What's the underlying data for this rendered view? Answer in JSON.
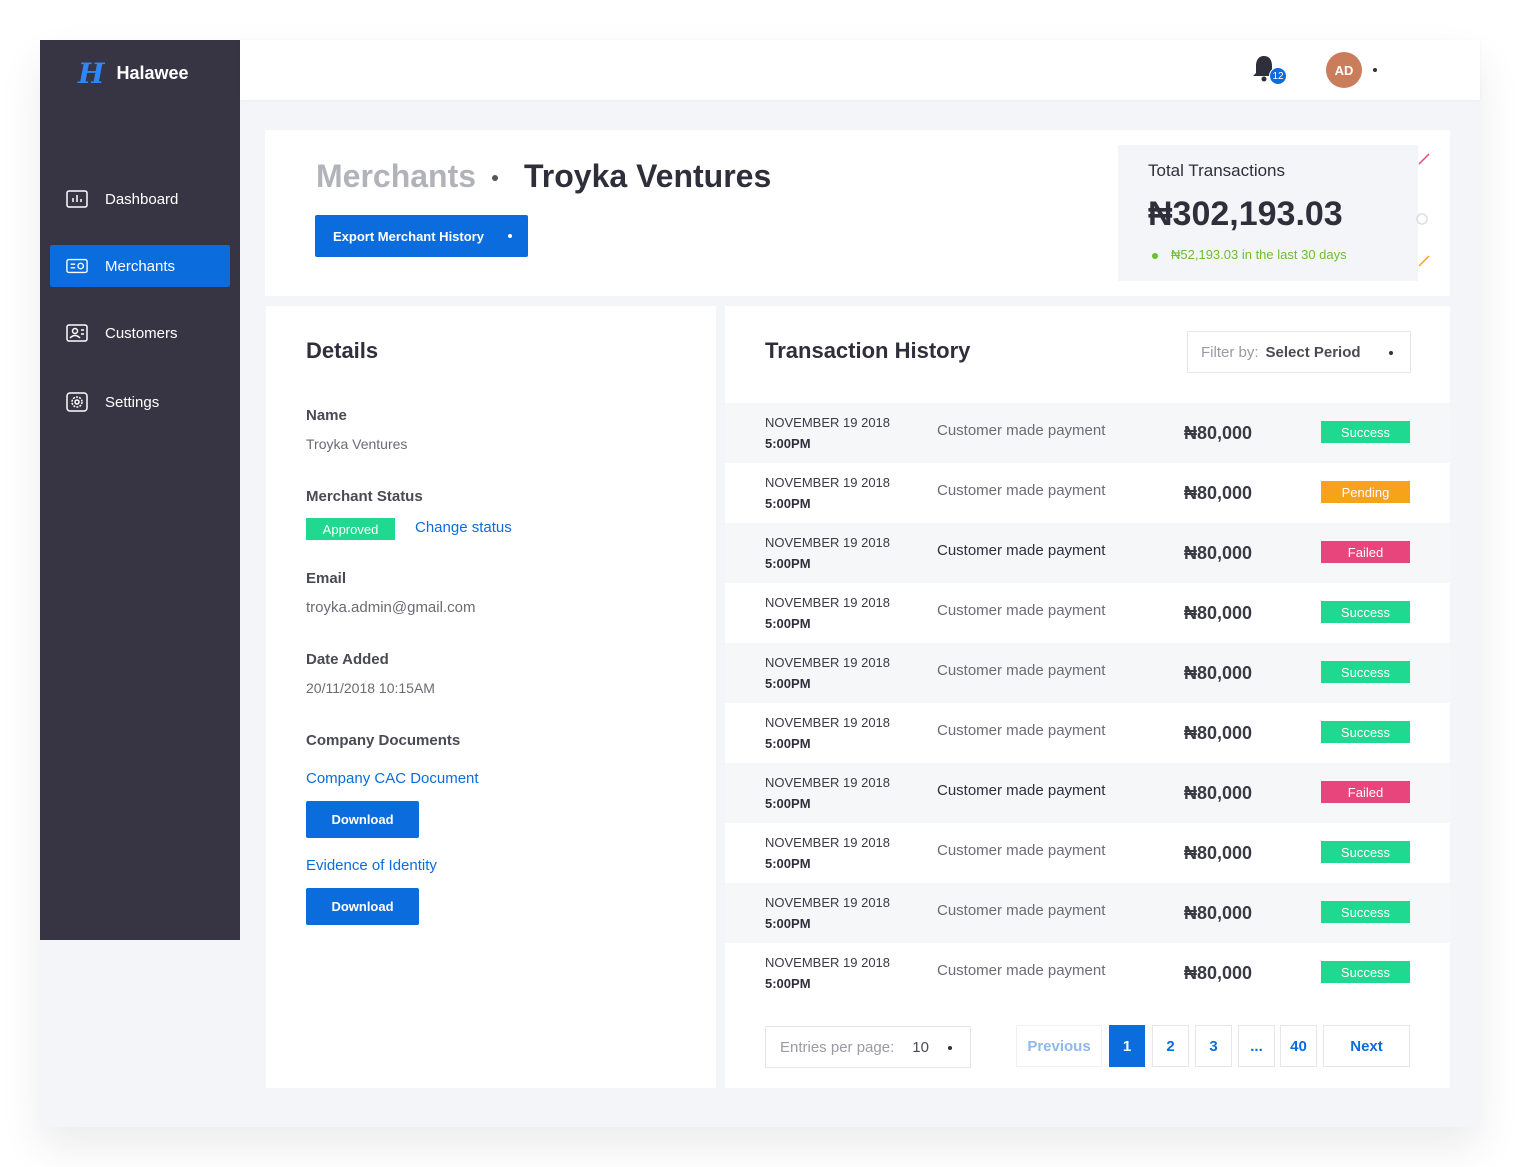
{
  "brand": {
    "logo": "H",
    "name": "Halawee"
  },
  "sidebar": {
    "items": [
      {
        "label": "Dashboard",
        "icon": "bar-chart-icon"
      },
      {
        "label": "Merchants",
        "icon": "id-card-icon",
        "active": true
      },
      {
        "label": "Customers",
        "icon": "user-card-icon"
      },
      {
        "label": "Settings",
        "icon": "gear-icon"
      }
    ]
  },
  "topbar": {
    "notification_count": "12",
    "avatar_initials": "AD"
  },
  "header": {
    "breadcrumb_parent": "Merchants",
    "breadcrumb_current": "Troyka Ventures",
    "export_label": "Export Merchant History",
    "total_label": "Total Transactions",
    "total_value": "₦302,193.03",
    "total_delta": "₦52,193.03 in the last 30 days"
  },
  "details": {
    "title": "Details",
    "name_label": "Name",
    "name_value": "Troyka Ventures",
    "status_label": "Merchant Status",
    "status_value": "Approved",
    "change_status_label": "Change status",
    "email_label": "Email",
    "email_value": "troyka.admin@gmail.com",
    "date_label": "Date Added",
    "date_value": "20/11/2018 10:15AM",
    "docs_label": "Company Documents",
    "doc1_label": "Company CAC Document",
    "doc2_label": "Evidence of Identity",
    "download_label": "Download"
  },
  "transactions": {
    "title": "Transaction History",
    "filter_label": "Filter by:",
    "filter_value": "Select Period",
    "rows": [
      {
        "date": "NOVEMBER 19 2018",
        "time": "5:00PM",
        "description": "Customer made payment",
        "amount": "₦80,000",
        "status": "Success"
      },
      {
        "date": "NOVEMBER 19 2018",
        "time": "5:00PM",
        "description": "Customer made payment",
        "amount": "₦80,000",
        "status": "Pending"
      },
      {
        "date": "NOVEMBER 19 2018",
        "time": "5:00PM",
        "description": "Customer made payment",
        "amount": "₦80,000",
        "status": "Failed"
      },
      {
        "date": "NOVEMBER 19 2018",
        "time": "5:00PM",
        "description": "Customer made payment",
        "amount": "₦80,000",
        "status": "Success"
      },
      {
        "date": "NOVEMBER 19 2018",
        "time": "5:00PM",
        "description": "Customer made payment",
        "amount": "₦80,000",
        "status": "Success"
      },
      {
        "date": "NOVEMBER 19 2018",
        "time": "5:00PM",
        "description": "Customer made payment",
        "amount": "₦80,000",
        "status": "Success"
      },
      {
        "date": "NOVEMBER 19 2018",
        "time": "5:00PM",
        "description": "Customer made payment",
        "amount": "₦80,000",
        "status": "Failed"
      },
      {
        "date": "NOVEMBER 19 2018",
        "time": "5:00PM",
        "description": "Customer made payment",
        "amount": "₦80,000",
        "status": "Success"
      },
      {
        "date": "NOVEMBER 19 2018",
        "time": "5:00PM",
        "description": "Customer made payment",
        "amount": "₦80,000",
        "status": "Success"
      },
      {
        "date": "NOVEMBER 19 2018",
        "time": "5:00PM",
        "description": "Customer made payment",
        "amount": "₦80,000",
        "status": "Success"
      }
    ],
    "status_colors": {
      "Success": "#1ed98f",
      "Pending": "#f7a21b",
      "Failed": "#e8457c"
    },
    "entries_label": "Entries per page:",
    "entries_value": "10",
    "pagination": {
      "previous": "Previous",
      "pages": [
        "1",
        "2",
        "3",
        "...",
        "40"
      ],
      "current": "1",
      "next": "Next"
    }
  },
  "colors": {
    "primary": "#0a6cdd",
    "sidebar": "#373544",
    "background": "#f4f5f8",
    "positive": "#6cbf2f"
  }
}
